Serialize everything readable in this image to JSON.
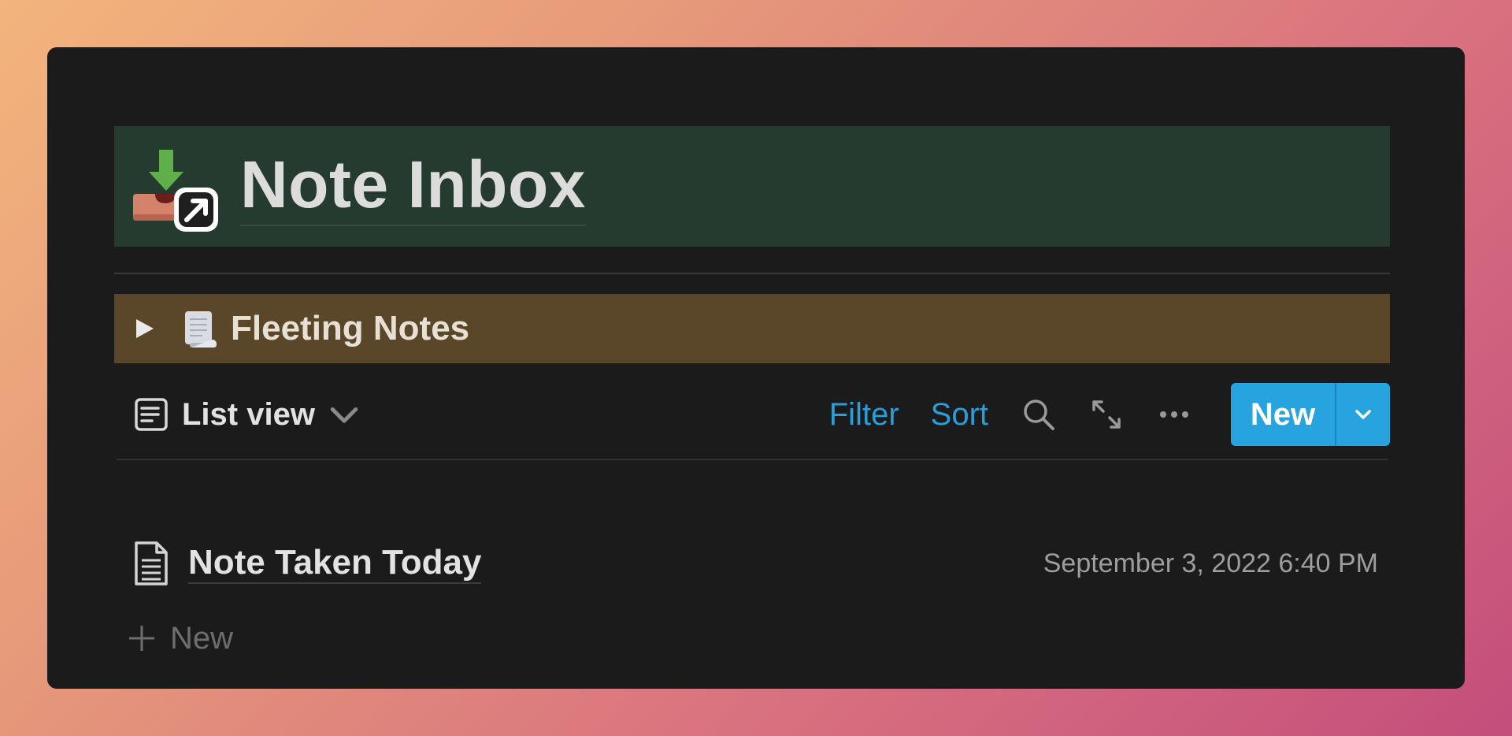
{
  "page": {
    "title": "Note Inbox",
    "title_icon": "inbox-tray-shortcut-icon"
  },
  "toggle": {
    "label": "Fleeting Notes",
    "icon": "scroll-page-icon",
    "bg_color": "#5a4629"
  },
  "toolbar": {
    "view_label": "List view",
    "filter_label": "Filter",
    "sort_label": "Sort",
    "new_label": "New",
    "accent_color": "#27a3e0"
  },
  "rows": [
    {
      "title": "Note Taken Today",
      "date": "September 3, 2022 6:40 PM"
    }
  ],
  "add_new_label": "New"
}
